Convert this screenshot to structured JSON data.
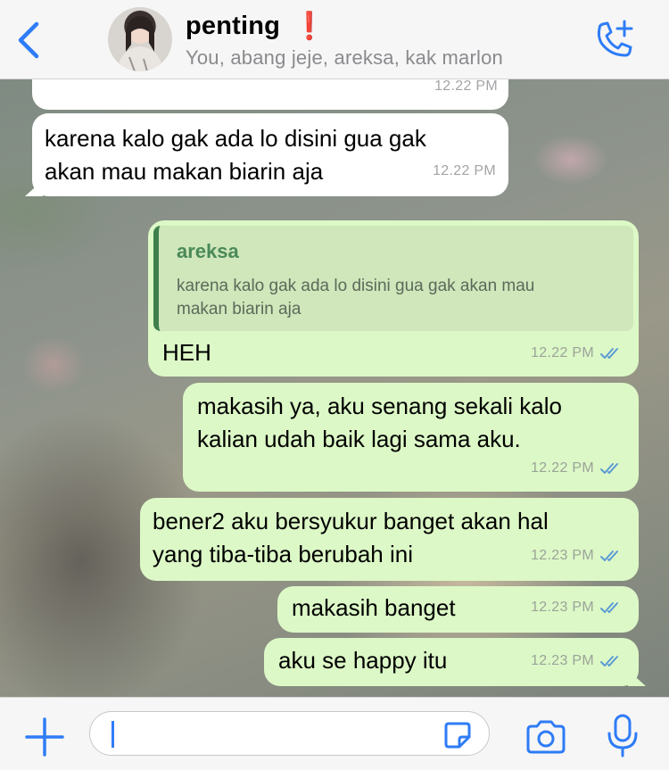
{
  "header": {
    "group_name": "penting",
    "badge": "❗",
    "members": "You, abang jeje, areksa, kak marlon",
    "accent_color": "#2e7cf6"
  },
  "messages": [
    {
      "direction": "incoming",
      "text": "",
      "time": "12.22 PM"
    },
    {
      "direction": "incoming",
      "text": "karena kalo gak ada lo disini gua gak\nakan mau makan biarin aja",
      "time": "12.22 PM"
    },
    {
      "direction": "outgoing",
      "reply": {
        "author": "areksa",
        "text": "karena kalo gak ada lo disini gua gak akan mau\nmakan biarin aja"
      },
      "text": "HEH",
      "time": "12.22 PM",
      "status": "read"
    },
    {
      "direction": "outgoing",
      "text": "makasih ya, aku senang sekali kalo\nkalian udah baik lagi sama aku.",
      "time": "12.22 PM",
      "status": "read"
    },
    {
      "direction": "outgoing",
      "text": "bener2 aku bersyukur banget akan hal\nyang tiba-tiba berubah ini",
      "time": "12.23 PM",
      "status": "read"
    },
    {
      "direction": "outgoing",
      "text": "makasih banget",
      "time": "12.23 PM",
      "status": "read"
    },
    {
      "direction": "outgoing",
      "text": "aku se happy itu",
      "time": "12.23 PM",
      "status": "read"
    }
  ],
  "input": {
    "placeholder": ""
  },
  "icons": [
    "back-chevron-icon",
    "add-call-icon",
    "plus-icon",
    "sticker-icon",
    "camera-icon",
    "mic-icon",
    "double-check-icon"
  ],
  "colors": {
    "outgoing_bubble": "#dcf8c6",
    "incoming_bubble": "#ffffff",
    "read_ticks": "#5b9bd5",
    "quote_bar": "#3f7f4d"
  }
}
